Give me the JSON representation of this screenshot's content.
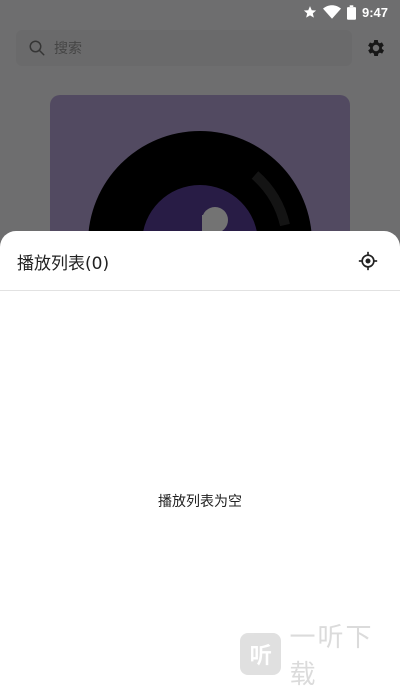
{
  "status_bar": {
    "time": "9:47",
    "icons": [
      "star-icon",
      "wifi-icon",
      "battery-icon"
    ]
  },
  "search": {
    "placeholder": "搜索"
  },
  "header": {
    "settings_icon": "gear-icon"
  },
  "album_art": {
    "icon": "vinyl-record"
  },
  "playlist_sheet": {
    "title": "播放列表(0)",
    "locate_icon": "locate-icon",
    "empty_message": "播放列表为空"
  },
  "watermark": {
    "logo": "听",
    "text": "一听下载"
  },
  "colors": {
    "accent": "#5a3f9a",
    "art_background": "#b6a5d8",
    "overlay": "rgba(0,0,0,0.55)"
  }
}
